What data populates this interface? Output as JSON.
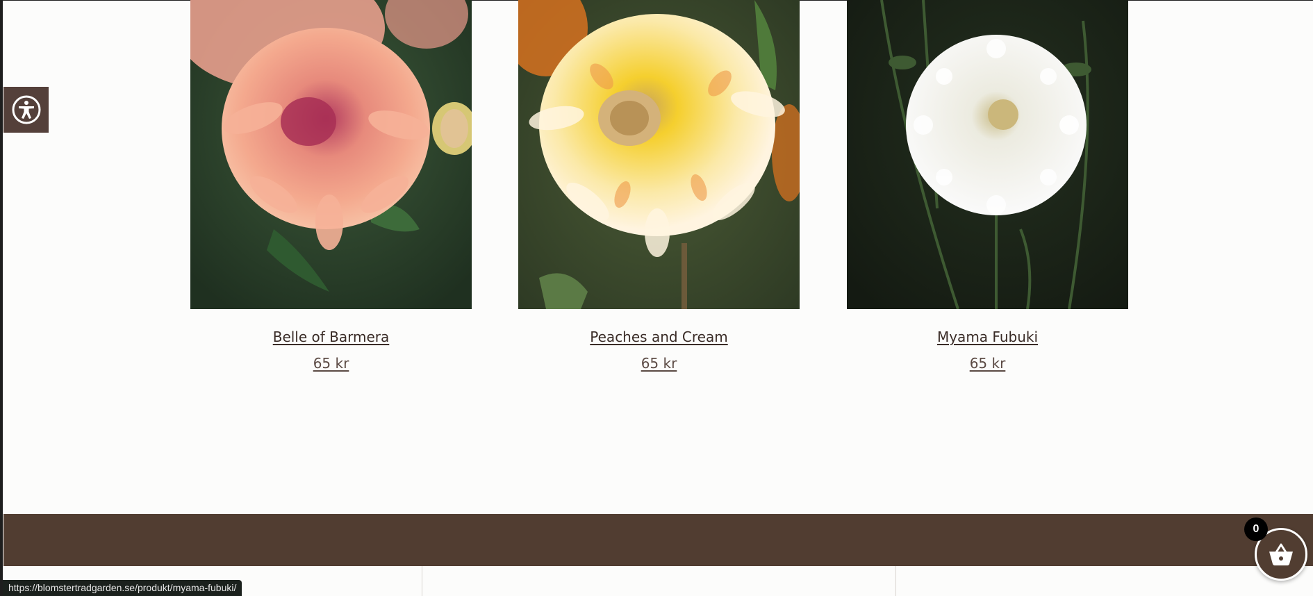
{
  "accessibility": {
    "icon": "accessibility-icon"
  },
  "products": [
    {
      "name": "Belle of Barmera",
      "price": "65 kr",
      "image_icon": "dahlia-pink-image"
    },
    {
      "name": "Peaches and Cream",
      "price": "65 kr",
      "image_icon": "dahlia-yellow-image"
    },
    {
      "name": "Myama Fubuki",
      "price": "65 kr",
      "image_icon": "dahlia-white-image"
    }
  ],
  "cart": {
    "count": "0",
    "icon": "basket-icon"
  },
  "status_bar": {
    "url": "https://blomstertradgarden.se/produkt/myama-fubuki/"
  },
  "colors": {
    "brand_brown": "#513d31",
    "background": "#fcfcfb"
  }
}
